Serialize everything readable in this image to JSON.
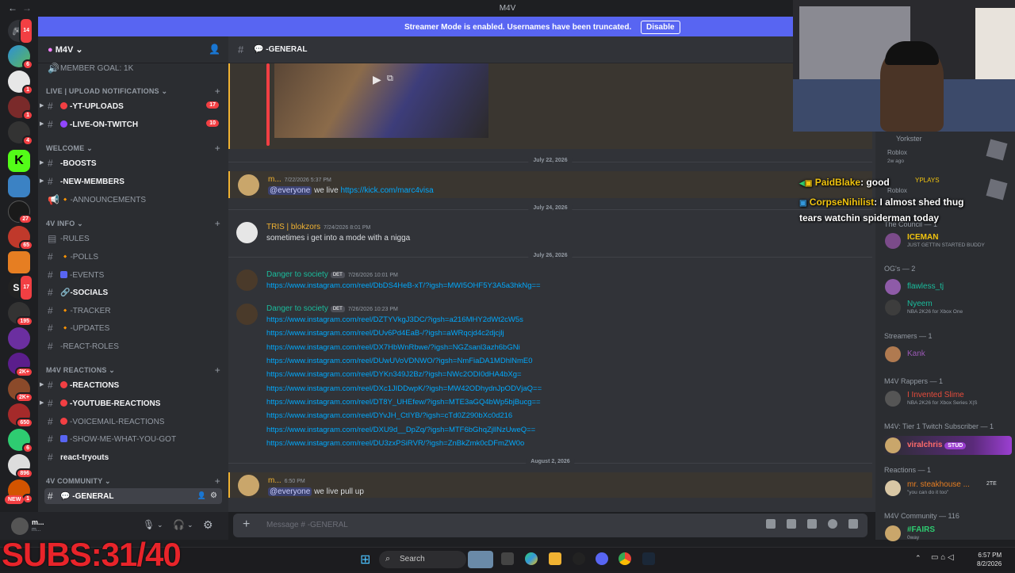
{
  "window": {
    "title": "M4V"
  },
  "banner": {
    "message": "Streamer Mode is enabled. Usernames have been truncated.",
    "disable_label": "Disable"
  },
  "rail": {
    "badges": [
      "14",
      "6",
      "1",
      "1",
      "4",
      "27",
      "65",
      "17",
      "195",
      "2K+",
      "2K+",
      "650",
      "6",
      "896",
      "1"
    ],
    "new_label": "NEW"
  },
  "guild": {
    "name": "M4V"
  },
  "sidebar": {
    "member_goal": "MEMBER GOAL: 1K",
    "cat_live": "LIVE | UPLOAD NOTIFICATIONS",
    "yt_uploads": "-YT-UPLOADS",
    "yt_uploads_count": "17",
    "live_twitch": "-LIVE-ON-TWITCH",
    "live_twitch_count": "10",
    "cat_welcome": "WELCOME",
    "boosts": "-BOOSTS",
    "new_members": "-NEW-MEMBERS",
    "announcements": "-ANNOUNCEMENTS",
    "cat_info": "4V INFO",
    "rules": "-RULES",
    "polls": "-POLLS",
    "events": "-EVENTS",
    "socials": "-SOCIALS",
    "tracker": "-TRACKER",
    "updates": "-UPDATES",
    "react_roles": "-REACT-ROLES",
    "cat_reactions": "M4V REACTIONS",
    "reactions": "-REACTIONS",
    "youtube_reactions": "-YOUTUBE-REACTIONS",
    "voicemail_reactions": "-VOICEMAIL-REACTIONS",
    "show_me": "-SHOW-ME-WHAT-YOU-GOT",
    "react_tryouts": "react-tryouts",
    "cat_community": "4V COMMUNITY",
    "general": "-GENERAL"
  },
  "user_panel": {
    "name": "m...",
    "status": "m..."
  },
  "chat_header": {
    "channel": "-GENERAL"
  },
  "messages": {
    "date1": "July 22, 2026",
    "m1_user": "m...",
    "m1_time": "7/22/2026 5:37 PM",
    "m1_mention": "@everyone",
    "m1_text": "we live",
    "m1_link": "https://kick.com/marc4visa",
    "date2": "July 24, 2026",
    "m2_user": "TRIS | blokzors",
    "m2_time": "7/24/2026 8:01 PM",
    "m2_text": "sometimes i get into a mode with a nigga",
    "date3": "July 26, 2026",
    "m3_user": "Danger to society",
    "m3_tag": "DET",
    "m3_time": "7/26/2026 10:01 PM",
    "m3_link": "https://www.instagram.com/reel/DbDS4HeB-xT/?igsh=MWI5OHF5Y3A5a3hkNg==",
    "m4_user": "Danger to society",
    "m4_tag": "DET",
    "m4_time": "7/26/2026 10:23 PM",
    "m4_links": [
      "https://www.instagram.com/reel/DZTYVkgJ3DC/?igsh=a216MHY2dWt2cW5s",
      "https://www.instagram.com/reel/DUv6Pd4EaB-/?igsh=aWRqcjd4c2djcjlj",
      "https://www.instagram.com/reel/DX7HbWnRbwe/?igsh=NGZsanl3azh6bGNi",
      "https://www.instagram.com/reel/DUwUVoVDNWO/?igsh=NmFiaDA1MDhlNmE0",
      "https://www.instagram.com/reel/DYKn349J2Bz/?igsh=NWc2ODI0dHA4bXg=",
      "https://www.instagram.com/reel/DXc1JIDDwpK/?igsh=MW42ODhydnJpODVjaQ==",
      "https://www.instagram.com/reel/DT8Y_UHEfew/?igsh=MTE3aGQ4bWp5bjBucg==",
      "https://www.instagram.com/reel/DYvJH_CtIYB/?igsh=cTd0Z290bXc0d216",
      "https://www.instagram.com/reel/DXU9d__DpZq/?igsh=MTF6bGhqZjllNzUweQ==",
      "https://www.instagram.com/reel/DU3zxPSiRVR/?igsh=ZnBkZmk0cDFmZW0o"
    ],
    "date4": "August 2, 2026",
    "m5_user": "m...",
    "m5_time": "6:50 PM",
    "m5_mention": "@everyone",
    "m5_text": "we live pull up"
  },
  "composer": {
    "placeholder": "Message # -GENERAL"
  },
  "members": {
    "r1_name": "Yorkster",
    "r1_status": "Roblox",
    "r1_sub": "2w ago",
    "r2_status": "Roblox",
    "cat_council": "The Council — 1",
    "iceman": "ICEMAN",
    "iceman_status": "JUST GETTIN STARTED BUDDY",
    "cat_ogs": "OG's — 2",
    "flawless": "flawless_tj",
    "nyeem": "Nyeem",
    "nyeem_status": "NBA 2K26 for Xbox One",
    "cat_streamers": "Streamers — 1",
    "kank": "Kank",
    "cat_rappers": "M4V Rappers — 1",
    "invented": "I Invented Slime",
    "invented_status": "NBA 2K26 for Xbox Series X|S",
    "cat_tier1": "M4V: Tier 1 Twitch Subscriber — 1",
    "viralchris": "viralchris",
    "viralchris_tag": "STUD",
    "cat_reactions": "Reactions — 1",
    "steakhouse": "mr. steakhouse ...",
    "steakhouse_tag": "2TE",
    "steakhouse_status": "\"you can do it too\"",
    "cat_community": "M4V Community — 116",
    "fairs": "#FAIRS",
    "fairs_status": "0way"
  },
  "overlay": {
    "line1_user": "PaidBlake",
    "line1_text": ": good",
    "line2_user": "CorpseNihilist",
    "line2_text": ": I almost shed thug",
    "line3_text": "tears watchin spiderman today",
    "plays_fragment": "YPLAYS"
  },
  "taskbar": {
    "search": "Search",
    "time": "6:57 PM",
    "date": "8/2/2026"
  },
  "subs": "SUBS:31/40",
  "colors": {
    "accent": "#5865f2",
    "link": "#00a8fc",
    "mention_bar": "#f0b232",
    "danger": "#f23f43",
    "subs": "#e8242a"
  }
}
